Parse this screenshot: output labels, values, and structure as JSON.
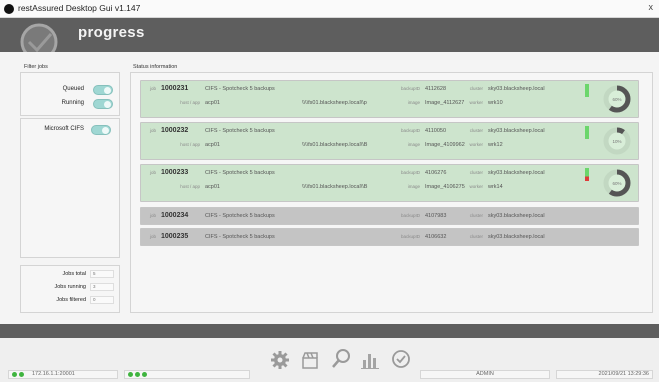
{
  "window": {
    "title": "restAssured Desktop Gui v1.147",
    "close_label": "x"
  },
  "header": {
    "title": "progress"
  },
  "filter_jobs": {
    "section_label": "Filter jobs",
    "filters": [
      {
        "label": "Queued",
        "on": true
      },
      {
        "label": "Running",
        "on": true
      }
    ],
    "service_filter": {
      "label": "Microsoft CIFS",
      "on": true
    },
    "stats": [
      {
        "label": "Jobs total",
        "value": "5"
      },
      {
        "label": "Jobs running",
        "value": "3"
      },
      {
        "label": "Jobs filtered",
        "value": "0"
      }
    ]
  },
  "status_info": {
    "section_label": "Status information",
    "field_labels": {
      "job": "job",
      "host": "host / app",
      "backup": "backupID",
      "image": "image",
      "cluster": "cluster",
      "worker": "worker"
    },
    "jobs": [
      {
        "id": "1000231",
        "desc": "CIFS - Spotcheck 5 backups",
        "host": "acp01",
        "path": "\\\\\\\\fs01.blacksheep.local\\\\p",
        "backup_id": "4112628",
        "image": "Image_4112627",
        "cluster": "sky03.blacksheep.local",
        "worker": "wrk10",
        "progress": "60%",
        "progress_value": 0.6,
        "status": "running"
      },
      {
        "id": "1000232",
        "desc": "CIFS - Spotcheck 5 backups",
        "host": "acp01",
        "path": "\\\\\\\\fs01.blacksheep.local\\\\B",
        "backup_id": "4110050",
        "image": "Image_4109962",
        "cluster": "sky03.blacksheep.local",
        "worker": "wrk12",
        "progress": "10%",
        "progress_value": 0.1,
        "status": "running"
      },
      {
        "id": "1000233",
        "desc": "CIFS - Spotcheck 5 backups",
        "host": "acp01",
        "path": "\\\\\\\\fs01.blacksheep.local\\\\B",
        "backup_id": "4106276",
        "image": "Image_4106275",
        "cluster": "sky03.blacksheep.local",
        "worker": "wrk14",
        "progress": "60%",
        "progress_value": 0.6,
        "status": "running-warn"
      },
      {
        "id": "1000234",
        "desc": "CIFS - Spotcheck 5 backups",
        "backup_id": "4107983",
        "cluster": "sky03.blacksheep.local",
        "status": "queued"
      },
      {
        "id": "1000235",
        "desc": "CIFS - Spotcheck 5 backups",
        "backup_id": "4106632",
        "cluster": "sky03.blacksheep.local",
        "status": "queued"
      }
    ]
  },
  "status_bar": {
    "ip": "172.16.1.1:20001",
    "user": "ADMIN",
    "datetime": "2021/09/21 13:29:36"
  },
  "toolbar_icons": [
    "gear-icon",
    "clapper-icon",
    "search-icon",
    "chart-icon",
    "clock-icon"
  ],
  "colors": {
    "header_bg": "#5e5e5e",
    "active_row": "#cde4cd",
    "inactive_row": "#c4c4c4",
    "toggle": "#9fd7d3",
    "ok": "#3fb43f",
    "warn": "#e03a3a"
  }
}
